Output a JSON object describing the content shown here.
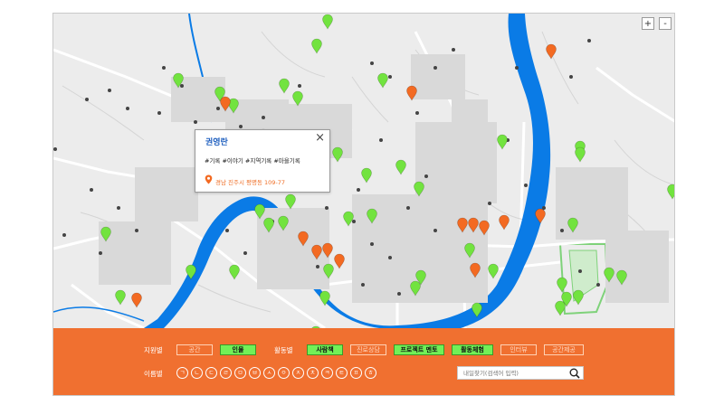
{
  "map": {
    "zoom_in": "+",
    "zoom_out": "-",
    "colors": {
      "green_marker": "#72e33f",
      "orange_marker": "#f36a22",
      "river": "#0a7be6",
      "land": "#ececec"
    },
    "green_markers": 44,
    "orange_markers": 14
  },
  "popup": {
    "title": "권영란",
    "tags": "#기록 #이야기 #지역기록 #마을기록",
    "address": "경남 진주시 평명동 109-77",
    "close": "×"
  },
  "filters": {
    "region_label": "지원별",
    "region_chips": [
      {
        "label": "공간",
        "active": false
      },
      {
        "label": "인물",
        "active": true
      }
    ],
    "activity_label": "활동별",
    "activity_chips": [
      {
        "label": "사람책",
        "active": true
      },
      {
        "label": "진로상담",
        "active": false
      },
      {
        "label": "프로젝트 멘토",
        "active": true
      },
      {
        "label": "활동체험",
        "active": true
      },
      {
        "label": "인터뷰",
        "active": false
      },
      {
        "label": "공간제공",
        "active": false
      }
    ],
    "name_label": "이름별",
    "consonants": [
      "ㄱ",
      "ㄴ",
      "ㄷ",
      "ㄹ",
      "ㅁ",
      "ㅂ",
      "ㅅ",
      "ㅇ",
      "ㅈ",
      "ㅊ",
      "ㅋ",
      "ㅌ",
      "ㅍ",
      "ㅎ"
    ],
    "search_placeholder": "내일찾기(검색어 입력)"
  }
}
